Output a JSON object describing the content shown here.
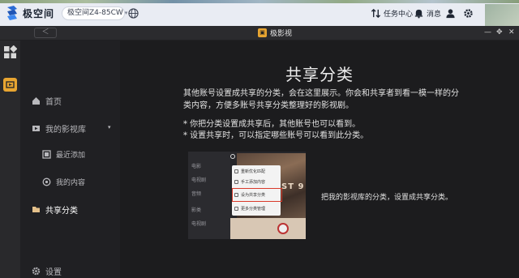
{
  "system_bar": {
    "brand": "极空间",
    "device": "极空间Z4-85CW",
    "task_center": "任务中心",
    "messages": "消息"
  },
  "app": {
    "back": "＜",
    "title": "极影视"
  },
  "sidebar": {
    "items": [
      {
        "label": "首页",
        "icon": "home-icon"
      },
      {
        "label": "我的影视库",
        "icon": "film-library-icon"
      },
      {
        "label": "最近添加",
        "icon": "recent-icon"
      },
      {
        "label": "我的内容",
        "icon": "content-icon"
      },
      {
        "label": "共享分类",
        "icon": "share-category-icon",
        "active": true
      },
      {
        "label": "设置",
        "icon": "gear-icon"
      }
    ]
  },
  "main": {
    "title": "共享分类",
    "paragraph": "其他账号设置成共享的分类，会在这里展示。你会和共享者到看一模一样的分类内容，方便多账号共享分类整理好的影视剧。",
    "bullets": [
      "* 你把分类设置成共享后，其他账号也可以看到。",
      "* 设置共享时，可以指定哪些账号可以看到此分类。"
    ],
    "caption": "把我的影视库的分类，设置成共享分类。",
    "preview": {
      "side_items": [
        "电影",
        "电视剧",
        "音频",
        "影类",
        "电视剧"
      ],
      "menu_items": [
        "重新优化匹配",
        "手工添加内容",
        "设为共享分类",
        "更多分类管理"
      ],
      "poster_text": "ST 9"
    }
  },
  "colors": {
    "accent": "#e8a531",
    "highlight": "#d93a2b",
    "background": "#1c1c1e"
  }
}
